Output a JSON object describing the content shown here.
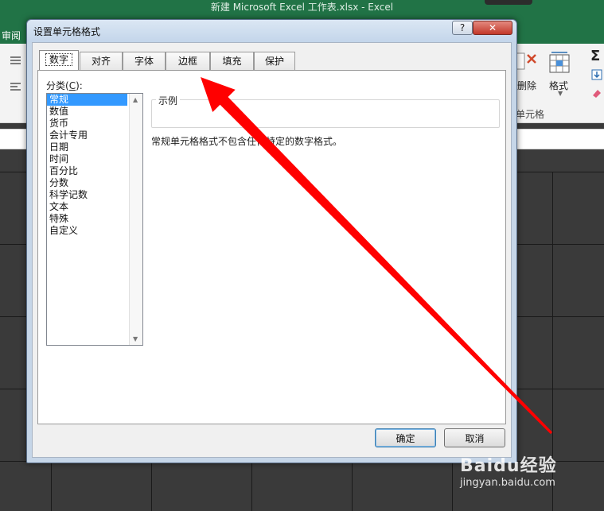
{
  "excel": {
    "window_title": "新建 Microsoft Excel 工作表.xlsx  -  Excel",
    "tab_review": "审阅",
    "ribbon_delete": "删除",
    "ribbon_format": "格式",
    "ribbon_group_cells": "单元格",
    "ribbon_sum_glyph": "Σ"
  },
  "dialog": {
    "title": "设置单元格格式",
    "help_label": "?",
    "close_label": "✕",
    "tabs": [
      {
        "label": "数字",
        "active": true
      },
      {
        "label": "对齐",
        "active": false
      },
      {
        "label": "字体",
        "active": false
      },
      {
        "label": "边框",
        "active": false
      },
      {
        "label": "填充",
        "active": false
      },
      {
        "label": "保护",
        "active": false
      }
    ],
    "category_label_prefix": "分类(",
    "category_label_key": "C",
    "category_label_suffix": "):",
    "categories": [
      "常规",
      "数值",
      "货币",
      "会计专用",
      "日期",
      "时间",
      "百分比",
      "分数",
      "科学记数",
      "文本",
      "特殊",
      "自定义"
    ],
    "selected_category": "常规",
    "sample_label": "示例",
    "sample_value": "",
    "description": "常规单元格格式不包含任何特定的数字格式。",
    "ok_label": "确定",
    "cancel_label": "取消"
  },
  "annotation": {
    "color": "#ff0000"
  },
  "watermark": {
    "brand": "Baidu经验",
    "url": "jingyan.baidu.com"
  }
}
